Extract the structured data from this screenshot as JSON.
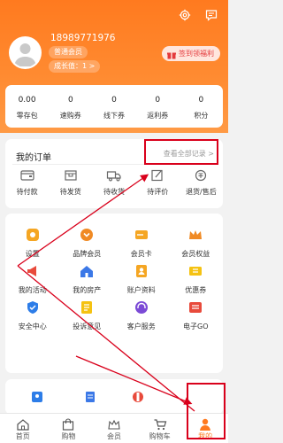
{
  "header": {
    "phone": "18989771976",
    "member_level": "普通会员",
    "growth": "成长值：1 >",
    "signin_label": "签到领福利",
    "icons": [
      "gear-icon",
      "message-icon"
    ]
  },
  "stats": [
    {
      "value": "0.00",
      "label": "零存包"
    },
    {
      "value": "0",
      "label": "速购券"
    },
    {
      "value": "0",
      "label": "线下券"
    },
    {
      "value": "0",
      "label": "返利券"
    },
    {
      "value": "0",
      "label": "积分"
    }
  ],
  "orders": {
    "title": "我的订单",
    "view_all": "查看全部记录 >",
    "items": [
      {
        "label": "待付款",
        "icon": "wallet-icon"
      },
      {
        "label": "待发货",
        "icon": "box-icon"
      },
      {
        "label": "待收货",
        "icon": "truck-icon"
      },
      {
        "label": "待评价",
        "icon": "pencil-icon"
      },
      {
        "label": "退货/售后",
        "icon": "refund-icon"
      }
    ]
  },
  "services": [
    {
      "label": "设置",
      "icon": "settings-icon",
      "color": "#f5a623"
    },
    {
      "label": "品牌会员",
      "icon": "brand-member-icon",
      "color": "#f08a24"
    },
    {
      "label": "会员卡",
      "icon": "card-icon",
      "color": "#f5a623"
    },
    {
      "label": "会员权益",
      "icon": "crown-icon",
      "color": "#f08a24"
    },
    {
      "label": "我的活动",
      "icon": "megaphone-icon",
      "color": "#e84a3b"
    },
    {
      "label": "我的房产",
      "icon": "house-icon",
      "color": "#3b78e7"
    },
    {
      "label": "账户资料",
      "icon": "profile-icon",
      "color": "#f5a623"
    },
    {
      "label": "优惠券",
      "icon": "coupon-icon",
      "color": "#f5c211"
    },
    {
      "label": "安全中心",
      "icon": "shield-icon",
      "color": "#2d7de8"
    },
    {
      "label": "投诉意见",
      "icon": "feedback-icon",
      "color": "#f5c211"
    },
    {
      "label": "客户服务",
      "icon": "headset-icon",
      "color": "#7b4ad6"
    },
    {
      "label": "电子GO",
      "icon": "ego-icon",
      "color": "#e84a3b"
    }
  ],
  "tabbar": [
    {
      "label": "首页",
      "icon": "home-icon"
    },
    {
      "label": "购物",
      "icon": "shopping-bag-icon"
    },
    {
      "label": "会员",
      "icon": "member-crown-icon"
    },
    {
      "label": "购物车",
      "icon": "cart-icon"
    },
    {
      "label": "我的",
      "icon": "user-icon",
      "active": true
    }
  ],
  "colors": {
    "brand_orange": "#ff7a1f",
    "highlight_red": "#d9001b"
  }
}
